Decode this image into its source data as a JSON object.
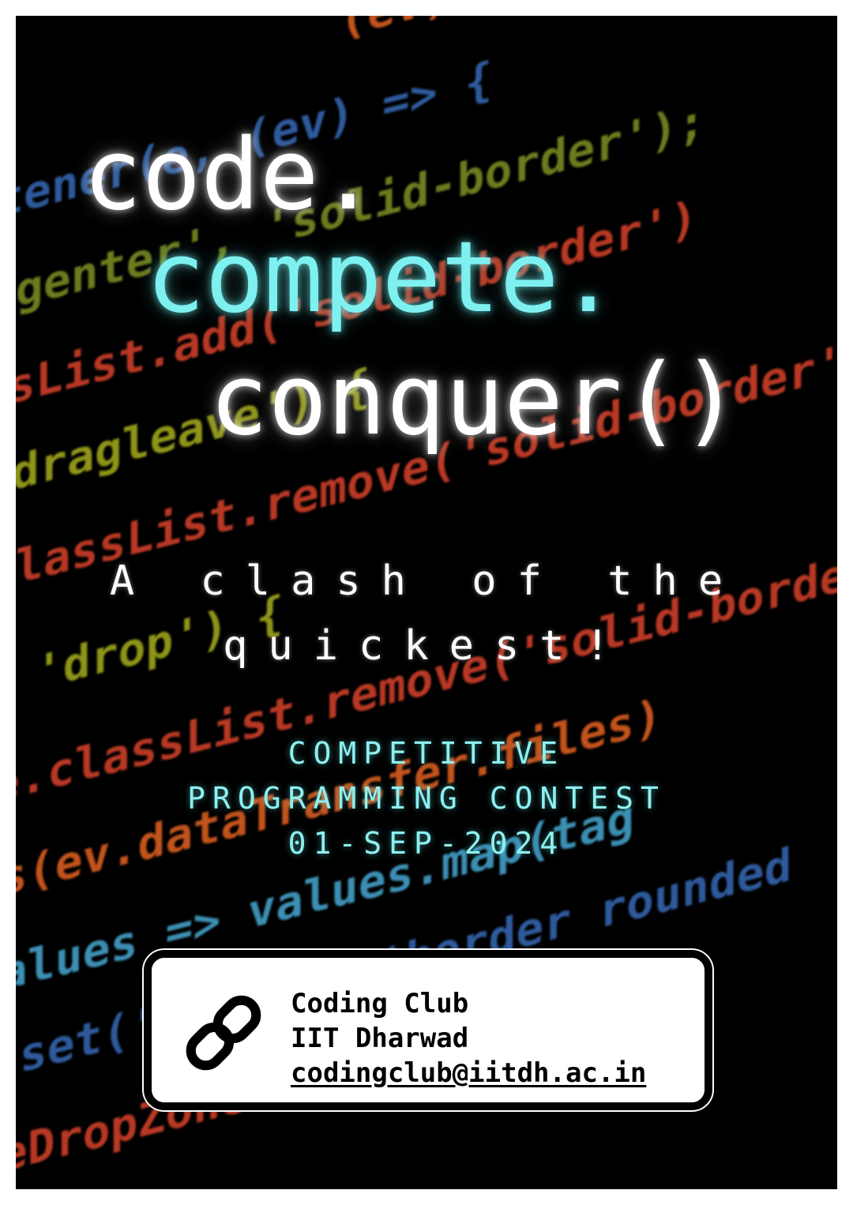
{
  "poster": {
    "background_code": [
      {
        "cls": "tok-o",
        "text": "(ev) => {"
      },
      {
        "cls": "tok-b",
        "text": "stener(e, (ev) => {"
      },
      {
        "cls": "tok-g",
        "text": "ragenter', 'solid-border');"
      },
      {
        "cls": "tok-r",
        "text": "assList.add('solid-border')"
      },
      {
        "cls": "tok-y",
        "text": "'dragleave') {"
      },
      {
        "cls": "tok-r",
        "text": ".classList.remove('solid-border')"
      },
      {
        "cls": "tok-y",
        "text": "== 'drop') {"
      },
      {
        "cls": "tok-r",
        "text": "one.classList.remove('solid-border')"
      },
      {
        "cls": "tok-o",
        "text": "les(ev.dataTransfer.files)"
      },
      {
        "cls": "tok-c",
        "text": "(values => values.map(tag"
      },
      {
        "cls": "tok-b",
        "text": "ag.set('class', 'border rounded"
      },
      {
        "cls": "tok-r",
        "text": "ileDropZone"
      }
    ],
    "headline": {
      "line1": "code.",
      "line2": "compete.",
      "line3": "conquer()"
    },
    "tagline": {
      "line1": "A clash of the",
      "line2": "quickest!"
    },
    "event": {
      "line1": "COMPETITIVE",
      "line2": "PROGRAMMING CONTEST",
      "date": "01-SEP-2024"
    },
    "contact": {
      "icon": "link-icon",
      "org_line1": "Coding Club",
      "org_line2": "IIT Dharwad",
      "email": "codingclub@iitdh.ac.in"
    }
  }
}
